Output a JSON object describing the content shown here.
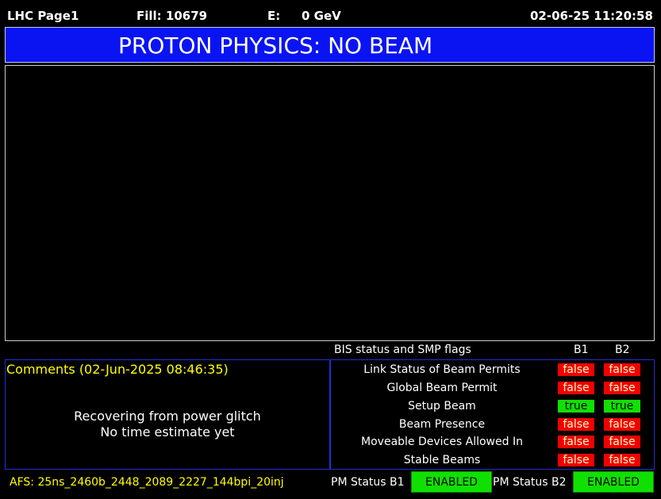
{
  "header": {
    "page_name": "LHC Page1",
    "fill": "Fill: 10679",
    "energy_label": "E:",
    "energy_value": "0 GeV",
    "datetime": "02-06-25 11:20:58"
  },
  "banner": {
    "status": "PROTON PHYSICS: NO BEAM",
    "color": "#0a14f2"
  },
  "bis": {
    "title": "BIS status and SMP flags",
    "col_b1": "B1",
    "col_b2": "B2",
    "flags": [
      {
        "label": "Link Status of Beam Permits",
        "b1": "false",
        "b2": "false"
      },
      {
        "label": "Global Beam Permit",
        "b1": "false",
        "b2": "false"
      },
      {
        "label": "Setup Beam",
        "b1": "true",
        "b2": "true"
      },
      {
        "label": "Beam Presence",
        "b1": "false",
        "b2": "false"
      },
      {
        "label": "Moveable Devices Allowed In",
        "b1": "false",
        "b2": "false"
      },
      {
        "label": "Stable Beams",
        "b1": "false",
        "b2": "false"
      }
    ]
  },
  "comments": {
    "title": "Comments (02-Jun-2025 08:46:35)",
    "line1": "Recovering from power glitch",
    "line2": "No time estimate yet"
  },
  "footer": {
    "afs": "AFS: 25ns_2460b_2448_2089_2227_144bpi_20inj",
    "pm_b1_label": "PM Status B1",
    "pm_b1_value": "ENABLED",
    "pm_b2_label": "PM Status B2",
    "pm_b2_value": "ENABLED"
  },
  "colors": {
    "false_bg": "#f20000",
    "true_bg": "#10e000",
    "comment_text": "#ffff00"
  }
}
